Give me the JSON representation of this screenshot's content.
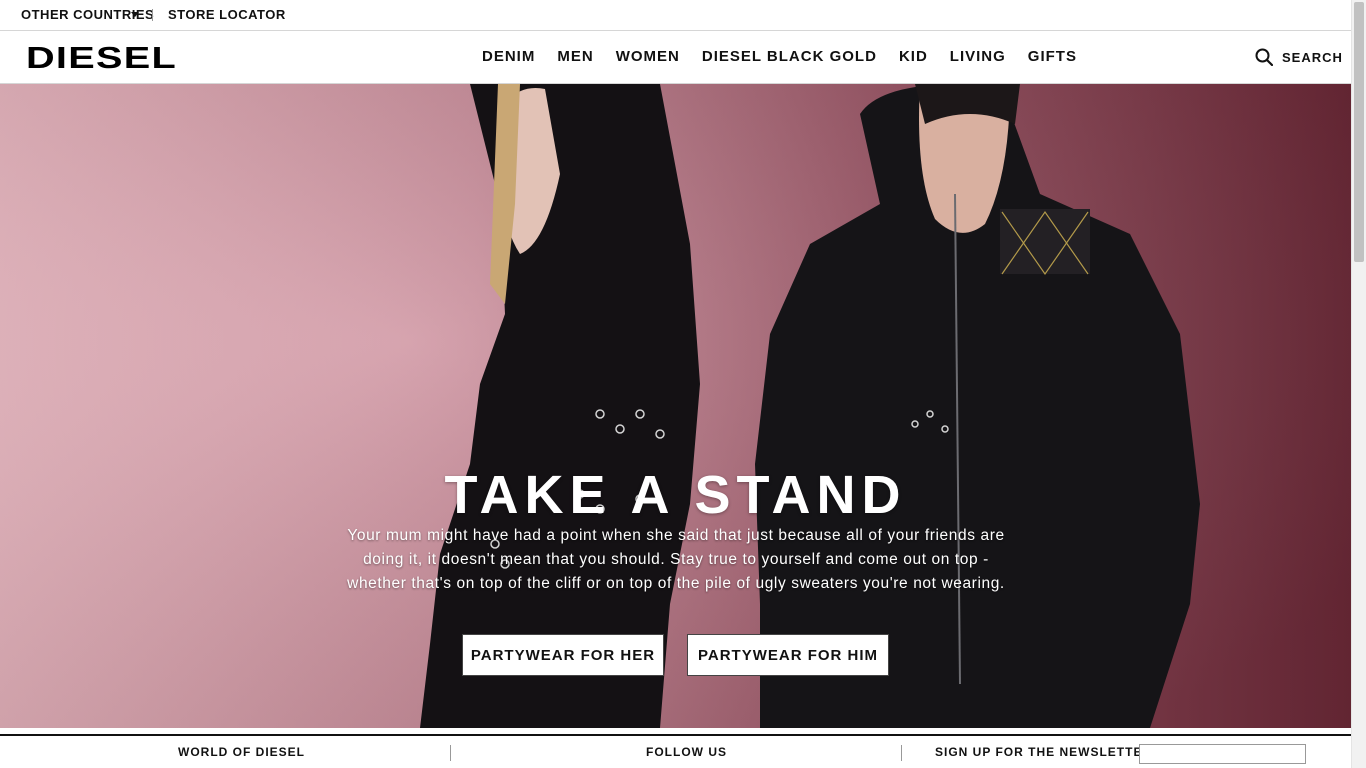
{
  "utility": {
    "countries_label": "OTHER COUNTRIES",
    "store_locator_label": "STORE LOCATOR"
  },
  "header": {
    "logo_text": "DIESEL",
    "nav": [
      "DENIM",
      "MEN",
      "WOMEN",
      "DIESEL BLACK GOLD",
      "KID",
      "LIVING",
      "GIFTS"
    ],
    "search_label": "SEARCH",
    "search_icon": "search-icon"
  },
  "hero": {
    "title": "TAKE A STAND",
    "text": "Your mum might have had a point when she said that just because all of your friends are doing it, it doesn't mean that you should. Stay true to yourself and come out on top - whether that's on top of the cliff or on top of the pile of ugly sweaters you're not wearing.",
    "cta_her": "PARTYWEAR FOR HER",
    "cta_him": "PARTYWEAR FOR HIM",
    "bg_color_left": "#e8b3bd",
    "bg_color_right": "#6f2a39"
  },
  "footer": {
    "world_label": "WORLD OF DIESEL",
    "follow_label": "FOLLOW US",
    "newsletter_label": "SIGN UP FOR THE NEWSLETTER",
    "newsletter_value": ""
  }
}
